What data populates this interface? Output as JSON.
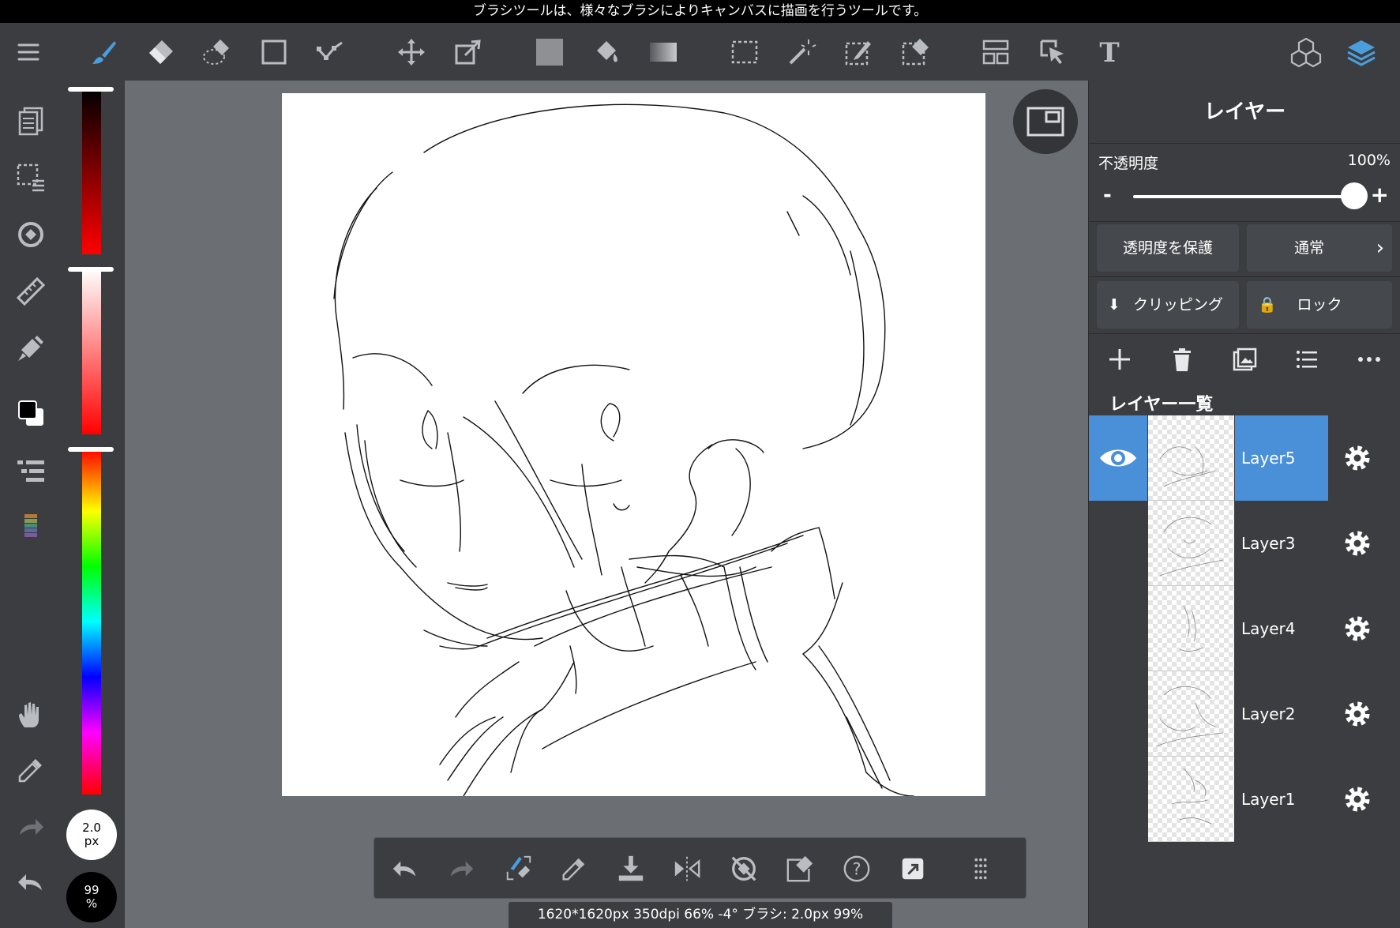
{
  "hint": "ブラシツールは、様々なブラシによりキャンバスに描画を行うツールです。",
  "toolbar": {
    "tools": [
      "menu-icon",
      "brush-icon",
      "eraser-icon",
      "blur-icon",
      "rectangle-shape-icon",
      "line-icon",
      "move-icon",
      "transform-icon",
      "fill-color-icon",
      "bucket-icon",
      "gradient-icon",
      "select-rect-icon",
      "magic-wand-icon",
      "select-pen-icon",
      "select-eraser-icon",
      "frame-divider-icon",
      "operation-icon",
      "text-icon",
      "materials-icon",
      "layers-icon"
    ],
    "active_tool": "brush-icon",
    "accent": "#4a9ede"
  },
  "left_tools": [
    "pages-icon",
    "selection-menu-icon",
    "rotate-reset-icon",
    "ruler-icon",
    "snap-icon",
    "color-swatch-icon",
    "brush-list-icon",
    "color-palette-icon",
    "hand-icon",
    "eyedropper-icon",
    "redo-icon",
    "undo-icon"
  ],
  "brush": {
    "size_value": "2.0",
    "size_unit": "px",
    "opacity_value": "99",
    "opacity_unit": "%",
    "color": "#000000"
  },
  "bottom_tools": [
    "undo-icon",
    "redo-icon",
    "brush-eraser-toggle-icon",
    "eyedropper-icon",
    "save-download-icon",
    "flip-icon",
    "rotate-lock-icon",
    "edit-shape-icon",
    "help-icon",
    "share-icon",
    "more-grid-icon"
  ],
  "status": "1620*1620px 350dpi 66% -4° ブラシ: 2.0px 99%",
  "panel": {
    "title": "レイヤー",
    "opacity_label": "不透明度",
    "opacity_value": "100%",
    "opacity_fraction": 1.0,
    "minus": "-",
    "plus": "+",
    "protect_alpha": "透明度を保護",
    "blend_mode": "通常",
    "clipping": "クリッピング",
    "lock": "ロック",
    "list_title": "レイヤー一覧",
    "active_color": "#4a90d9",
    "layers": [
      {
        "name": "Layer5",
        "active": true
      },
      {
        "name": "Layer3",
        "active": false
      },
      {
        "name": "Layer4",
        "active": false
      },
      {
        "name": "Layer2",
        "active": false
      },
      {
        "name": "Layer1",
        "active": false
      }
    ]
  }
}
